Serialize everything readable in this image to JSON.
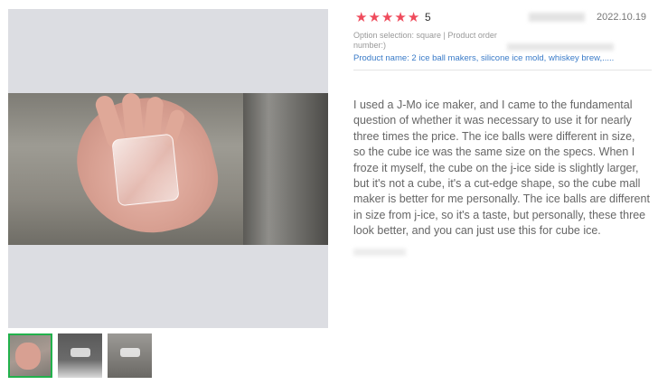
{
  "review": {
    "rating": {
      "stars": 5,
      "score_text": "5",
      "star_color": "#ef4b5c",
      "star_glyph": "★"
    },
    "date": "2022.10.19",
    "option_text": "Option selection: square | Product order number:)",
    "product_text": "Product name: 2 ice ball makers, silicone ice mold, whiskey brew,.....",
    "body": "I used a J-Mo ice maker, and I came to the fundamental question of whether it was necessary to use it for nearly three times the price. The ice balls were different in size, so the cube ice was the same size on the specs. When I froze it myself, the cube on the j-ice side is slightly larger, but it's not a cube, it's a cut-edge shape, so the cube mall maker is better for me personally. The ice balls are different in size from j-ice, so it's a taste, but personally, these three look better, and you can just use this for cube ice."
  },
  "gallery": {
    "selected_index": 0,
    "accent_color": "#22b14c",
    "thumbnails": [
      {
        "name": "hand-holding-ice-cube-photo"
      },
      {
        "name": "cube-mold-box-photo"
      },
      {
        "name": "cube-mold-package-photo"
      }
    ]
  }
}
